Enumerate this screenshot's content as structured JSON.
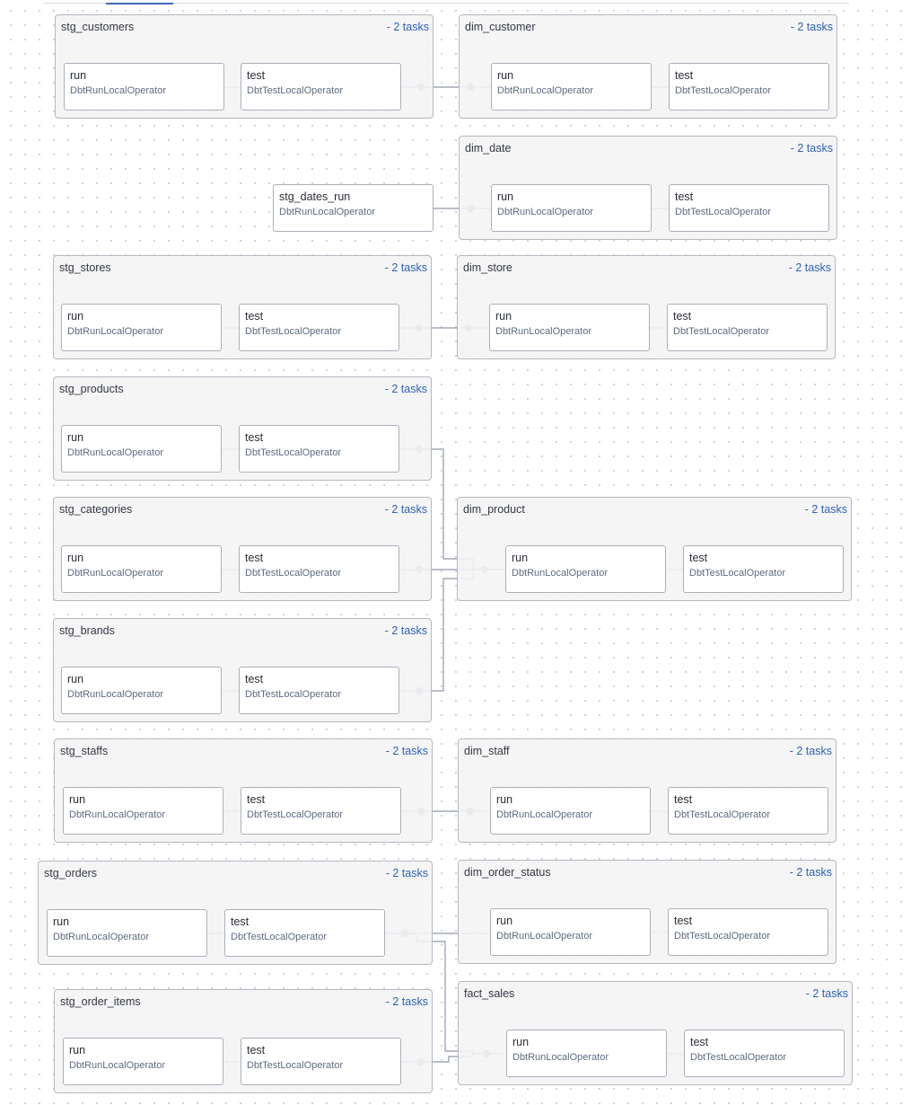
{
  "groups": [
    {
      "id": "stg_customers",
      "title": "stg_customers",
      "tasks_label": "- 2 tasks",
      "tasks": [
        {
          "name": "run",
          "operator": "DbtRunLocalOperator"
        },
        {
          "name": "test",
          "operator": "DbtTestLocalOperator"
        }
      ]
    },
    {
      "id": "dim_customer",
      "title": "dim_customer",
      "tasks_label": "- 2 tasks",
      "tasks": [
        {
          "name": "run",
          "operator": "DbtRunLocalOperator"
        },
        {
          "name": "test",
          "operator": "DbtTestLocalOperator"
        }
      ]
    },
    {
      "id": "dim_date",
      "title": "dim_date",
      "tasks_label": "- 2 tasks",
      "tasks": [
        {
          "name": "run",
          "operator": "DbtRunLocalOperator"
        },
        {
          "name": "test",
          "operator": "DbtTestLocalOperator"
        }
      ]
    },
    {
      "id": "stg_stores",
      "title": "stg_stores",
      "tasks_label": "- 2 tasks",
      "tasks": [
        {
          "name": "run",
          "operator": "DbtRunLocalOperator"
        },
        {
          "name": "test",
          "operator": "DbtTestLocalOperator"
        }
      ]
    },
    {
      "id": "dim_store",
      "title": "dim_store",
      "tasks_label": "- 2 tasks",
      "tasks": [
        {
          "name": "run",
          "operator": "DbtRunLocalOperator"
        },
        {
          "name": "test",
          "operator": "DbtTestLocalOperator"
        }
      ]
    },
    {
      "id": "stg_products",
      "title": "stg_products",
      "tasks_label": "- 2 tasks",
      "tasks": [
        {
          "name": "run",
          "operator": "DbtRunLocalOperator"
        },
        {
          "name": "test",
          "operator": "DbtTestLocalOperator"
        }
      ]
    },
    {
      "id": "stg_categories",
      "title": "stg_categories",
      "tasks_label": "- 2 tasks",
      "tasks": [
        {
          "name": "run",
          "operator": "DbtRunLocalOperator"
        },
        {
          "name": "test",
          "operator": "DbtTestLocalOperator"
        }
      ]
    },
    {
      "id": "dim_product",
      "title": "dim_product",
      "tasks_label": "- 2 tasks",
      "tasks": [
        {
          "name": "run",
          "operator": "DbtRunLocalOperator"
        },
        {
          "name": "test",
          "operator": "DbtTestLocalOperator"
        }
      ]
    },
    {
      "id": "stg_brands",
      "title": "stg_brands",
      "tasks_label": "- 2 tasks",
      "tasks": [
        {
          "name": "run",
          "operator": "DbtRunLocalOperator"
        },
        {
          "name": "test",
          "operator": "DbtTestLocalOperator"
        }
      ]
    },
    {
      "id": "stg_staffs",
      "title": "stg_staffs",
      "tasks_label": "- 2 tasks",
      "tasks": [
        {
          "name": "run",
          "operator": "DbtRunLocalOperator"
        },
        {
          "name": "test",
          "operator": "DbtTestLocalOperator"
        }
      ]
    },
    {
      "id": "dim_staff",
      "title": "dim_staff",
      "tasks_label": "- 2 tasks",
      "tasks": [
        {
          "name": "run",
          "operator": "DbtRunLocalOperator"
        },
        {
          "name": "test",
          "operator": "DbtTestLocalOperator"
        }
      ]
    },
    {
      "id": "stg_orders",
      "title": "stg_orders",
      "tasks_label": "- 2 tasks",
      "tasks": [
        {
          "name": "run",
          "operator": "DbtRunLocalOperator"
        },
        {
          "name": "test",
          "operator": "DbtTestLocalOperator"
        }
      ]
    },
    {
      "id": "dim_order_status",
      "title": "dim_order_status",
      "tasks_label": "- 2 tasks",
      "tasks": [
        {
          "name": "run",
          "operator": "DbtRunLocalOperator"
        },
        {
          "name": "test",
          "operator": "DbtTestLocalOperator"
        }
      ]
    },
    {
      "id": "stg_order_items",
      "title": "stg_order_items",
      "tasks_label": "- 2 tasks",
      "tasks": [
        {
          "name": "run",
          "operator": "DbtRunLocalOperator"
        },
        {
          "name": "test",
          "operator": "DbtTestLocalOperator"
        }
      ]
    },
    {
      "id": "fact_sales",
      "title": "fact_sales",
      "tasks_label": "- 2 tasks",
      "tasks": [
        {
          "name": "run",
          "operator": "DbtRunLocalOperator"
        },
        {
          "name": "test",
          "operator": "DbtTestLocalOperator"
        }
      ]
    }
  ],
  "standalone_tasks": [
    {
      "id": "stg_dates_run",
      "name": "stg_dates_run",
      "operator": "DbtRunLocalOperator"
    }
  ],
  "dependencies": [
    {
      "from": "stg_customers.test",
      "to": "dim_customer.run"
    },
    {
      "from": "stg_dates_run",
      "to": "dim_date.run"
    },
    {
      "from": "stg_stores.test",
      "to": "dim_store.run"
    },
    {
      "from": "stg_products.test",
      "to": "dim_product.run"
    },
    {
      "from": "stg_categories.test",
      "to": "dim_product.run"
    },
    {
      "from": "stg_brands.test",
      "to": "dim_product.run"
    },
    {
      "from": "stg_staffs.test",
      "to": "dim_staff.run"
    },
    {
      "from": "stg_orders.test",
      "to": "dim_order_status.run"
    },
    {
      "from": "stg_orders.test",
      "to": "fact_sales.run"
    },
    {
      "from": "stg_order_items.test",
      "to": "fact_sales.run"
    }
  ],
  "colors": {
    "edge": "#a2a9b8",
    "group_link": "#2e62b4",
    "node_border": "#aab0ba"
  }
}
